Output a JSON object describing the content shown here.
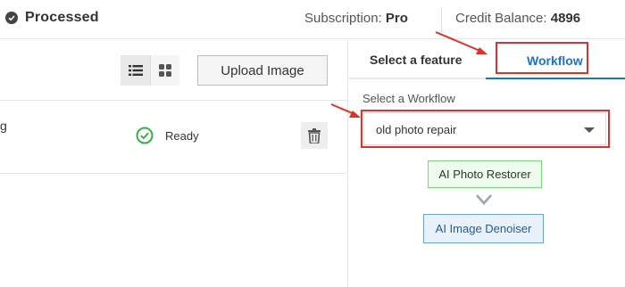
{
  "header": {
    "status_label": "Processed",
    "subscription_label": "Subscription:",
    "subscription_value": "Pro",
    "credit_label": "Credit Balance:",
    "credit_value": "4896"
  },
  "toolbar": {
    "upload_label": "Upload Image"
  },
  "file_row": {
    "name_fragment": "g",
    "status": "Ready"
  },
  "tabs": {
    "feature_label": "Select a feature",
    "workflow_label": "Workflow"
  },
  "workflow": {
    "select_label": "Select a Workflow",
    "selected_value": "old photo repair",
    "steps": [
      "AI Photo Restorer",
      "AI Image Denoiser"
    ]
  },
  "colors": {
    "accent": "#1a73c9",
    "annotation_red": "#e0302c",
    "ready_green": "#2fb344"
  }
}
